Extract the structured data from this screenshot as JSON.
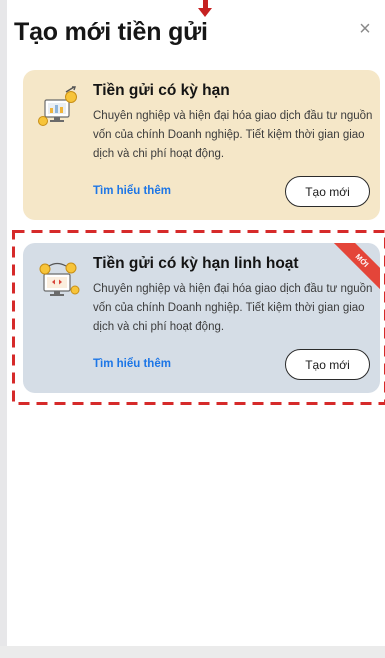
{
  "dialog": {
    "title": "Tạo mới tiền gửi",
    "close_label": "×"
  },
  "cards": [
    {
      "title": "Tiền gửi có kỳ hạn",
      "description": "Chuyên nghiệp và hiện đại hóa giao dịch đầu tư nguồn vốn của chính Doanh nghiệp. Tiết kiệm thời gian giao dịch và chi phí hoạt động.",
      "link_label": "Tìm hiểu thêm",
      "button_label": "Tạo mới",
      "icon": "term-deposit-icon",
      "background": "#f5e7c8"
    },
    {
      "title": "Tiền gửi có kỳ hạn linh hoạt",
      "description": "Chuyên nghiệp và hiện đại hóa giao dịch đầu tư nguồn vốn của chính Doanh nghiệp. Tiết kiệm thời gian giao dịch và chi phí hoạt động.",
      "link_label": "Tìm hiểu thêm",
      "button_label": "Tạo mới",
      "badge": "MỚI",
      "icon": "flexible-deposit-icon",
      "background": "#d5dde6"
    }
  ],
  "colors": {
    "link": "#1d76e6",
    "annotation": "#c62121",
    "badge": "#e44539"
  }
}
